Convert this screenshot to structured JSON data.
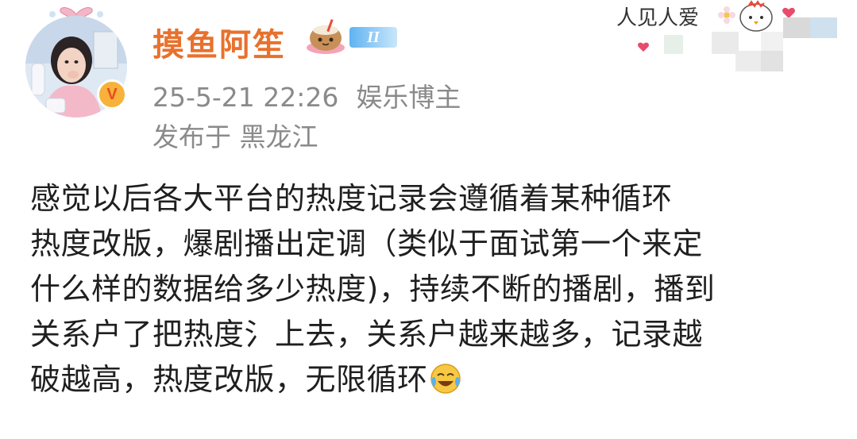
{
  "user": {
    "name": "摸鱼阿笙",
    "level": "II",
    "vip_letter": "V"
  },
  "meta": {
    "timestamp": "25-5-21 22:26",
    "role": "娱乐博主",
    "location": "发布于 黑龙江"
  },
  "decoration": {
    "text": "人见人爱"
  },
  "post": {
    "lines": [
      "感觉以后各大平台的热度记录会遵循着某种循环",
      "热度改版，爆剧播出定调（类似于面试第一个来定",
      "什么样的数据给多少热度)，持续不断的播剧，播到",
      "关系户了把热度氵上去，关系户越来越多，记录越",
      "破越高，热度改版，无限循环"
    ],
    "trailing_emoji": "laugh-cry-icon"
  },
  "colors": {
    "username": "#e8712d",
    "meta": "#8a8a8a",
    "body": "#1f1f1f",
    "vip_badge": "#f6b23a",
    "level_badge": "#5fb3f0"
  }
}
